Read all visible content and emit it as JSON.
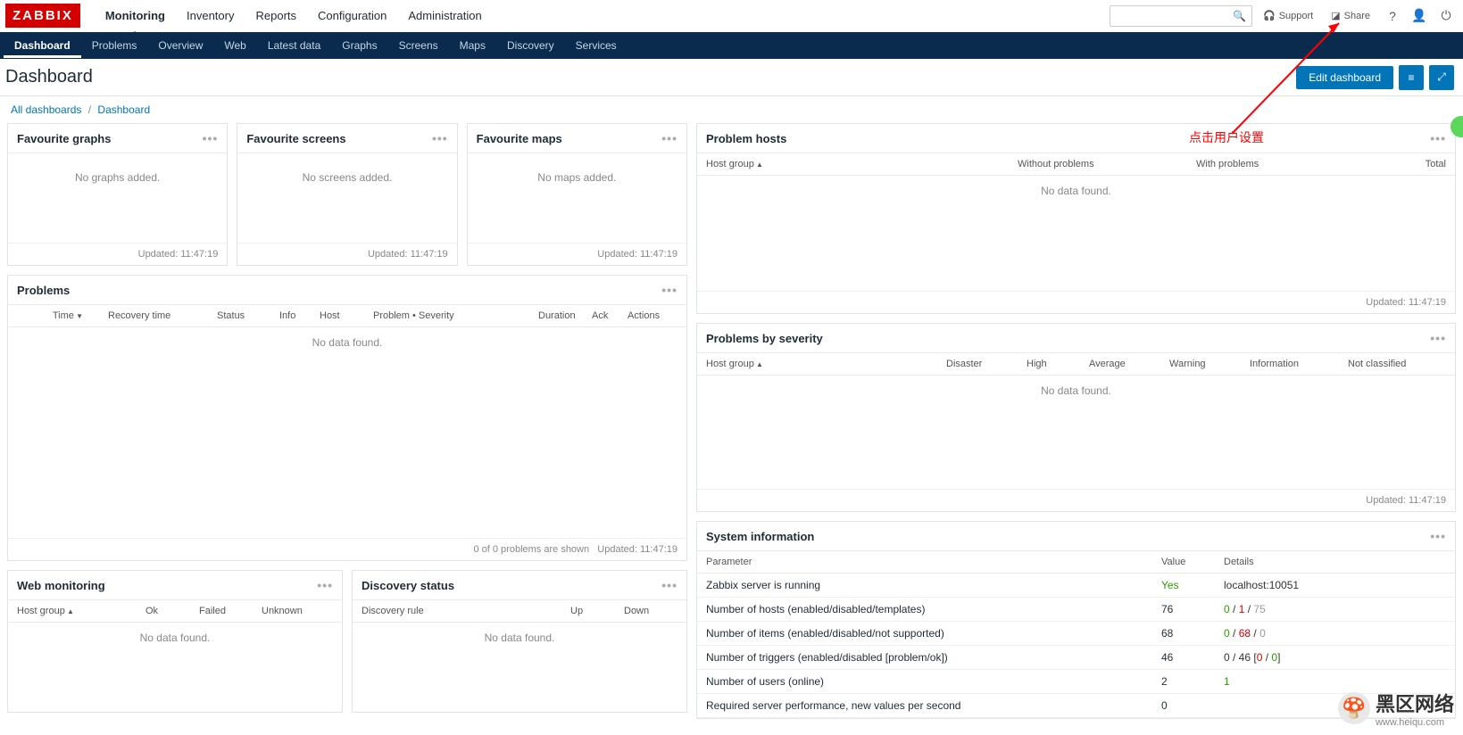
{
  "logo": "ZABBIX",
  "topnav": [
    "Monitoring",
    "Inventory",
    "Reports",
    "Configuration",
    "Administration"
  ],
  "top_right": {
    "support": "Support",
    "share": "Share"
  },
  "subnav": [
    "Dashboard",
    "Problems",
    "Overview",
    "Web",
    "Latest data",
    "Graphs",
    "Screens",
    "Maps",
    "Discovery",
    "Services"
  ],
  "page": {
    "title": "Dashboard",
    "edit_btn": "Edit dashboard"
  },
  "breadcrumb": {
    "all": "All dashboards",
    "current": "Dashboard"
  },
  "fav": {
    "graphs": {
      "title": "Favourite graphs",
      "empty": "No graphs added.",
      "updated": "Updated: 11:47:19"
    },
    "screens": {
      "title": "Favourite screens",
      "empty": "No screens added.",
      "updated": "Updated: 11:47:19"
    },
    "maps": {
      "title": "Favourite maps",
      "empty": "No maps added.",
      "updated": "Updated: 11:47:19"
    }
  },
  "problems": {
    "title": "Problems",
    "cols": {
      "time": "Time",
      "recovery": "Recovery time",
      "status": "Status",
      "info": "Info",
      "host": "Host",
      "problem": "Problem • Severity",
      "duration": "Duration",
      "ack": "Ack",
      "actions": "Actions"
    },
    "nodata": "No data found.",
    "foot_left": "0 of 0 problems are shown",
    "foot_right": "Updated: 11:47:19"
  },
  "web": {
    "title": "Web monitoring",
    "cols": {
      "hostgroup": "Host group",
      "ok": "Ok",
      "failed": "Failed",
      "unknown": "Unknown"
    },
    "nodata": "No data found."
  },
  "discovery": {
    "title": "Discovery status",
    "cols": {
      "rule": "Discovery rule",
      "up": "Up",
      "down": "Down"
    },
    "nodata": "No data found."
  },
  "problem_hosts": {
    "title": "Problem hosts",
    "cols": {
      "hostgroup": "Host group",
      "without": "Without problems",
      "with": "With problems",
      "total": "Total"
    },
    "nodata": "No data found.",
    "updated": "Updated: 11:47:19"
  },
  "severity": {
    "title": "Problems by severity",
    "cols": {
      "hostgroup": "Host group",
      "disaster": "Disaster",
      "high": "High",
      "average": "Average",
      "warning": "Warning",
      "information": "Information",
      "notclassified": "Not classified"
    },
    "nodata": "No data found.",
    "updated": "Updated: 11:47:19"
  },
  "sysinfo": {
    "title": "System information",
    "head": {
      "param": "Parameter",
      "value": "Value",
      "details": "Details"
    },
    "rows": [
      {
        "p": "Zabbix server is running",
        "v": "Yes",
        "v_class": "green",
        "d": "localhost:10051"
      },
      {
        "p": "Number of hosts (enabled/disabled/templates)",
        "v": "76",
        "d_html": "<span class='green'>0</span> / <span class='red'>1</span> / <span class='grey'>75</span>"
      },
      {
        "p": "Number of items (enabled/disabled/not supported)",
        "v": "68",
        "d_html": "<span class='green'>0</span> / <span class='red'>68</span> / <span class='grey'>0</span>"
      },
      {
        "p": "Number of triggers (enabled/disabled [problem/ok])",
        "v": "46",
        "d_html": "0 / 46 [<span class='red'>0</span> / <span class='green'>0</span>]"
      },
      {
        "p": "Number of users (online)",
        "v": "2",
        "d_html": "<span class='green'>1</span>"
      },
      {
        "p": "Required server performance, new values per second",
        "v": "0",
        "d": ""
      }
    ]
  },
  "annotation": "点击用户设置",
  "watermark": "黑区网络",
  "watermark_url": "www.heiqu.com"
}
